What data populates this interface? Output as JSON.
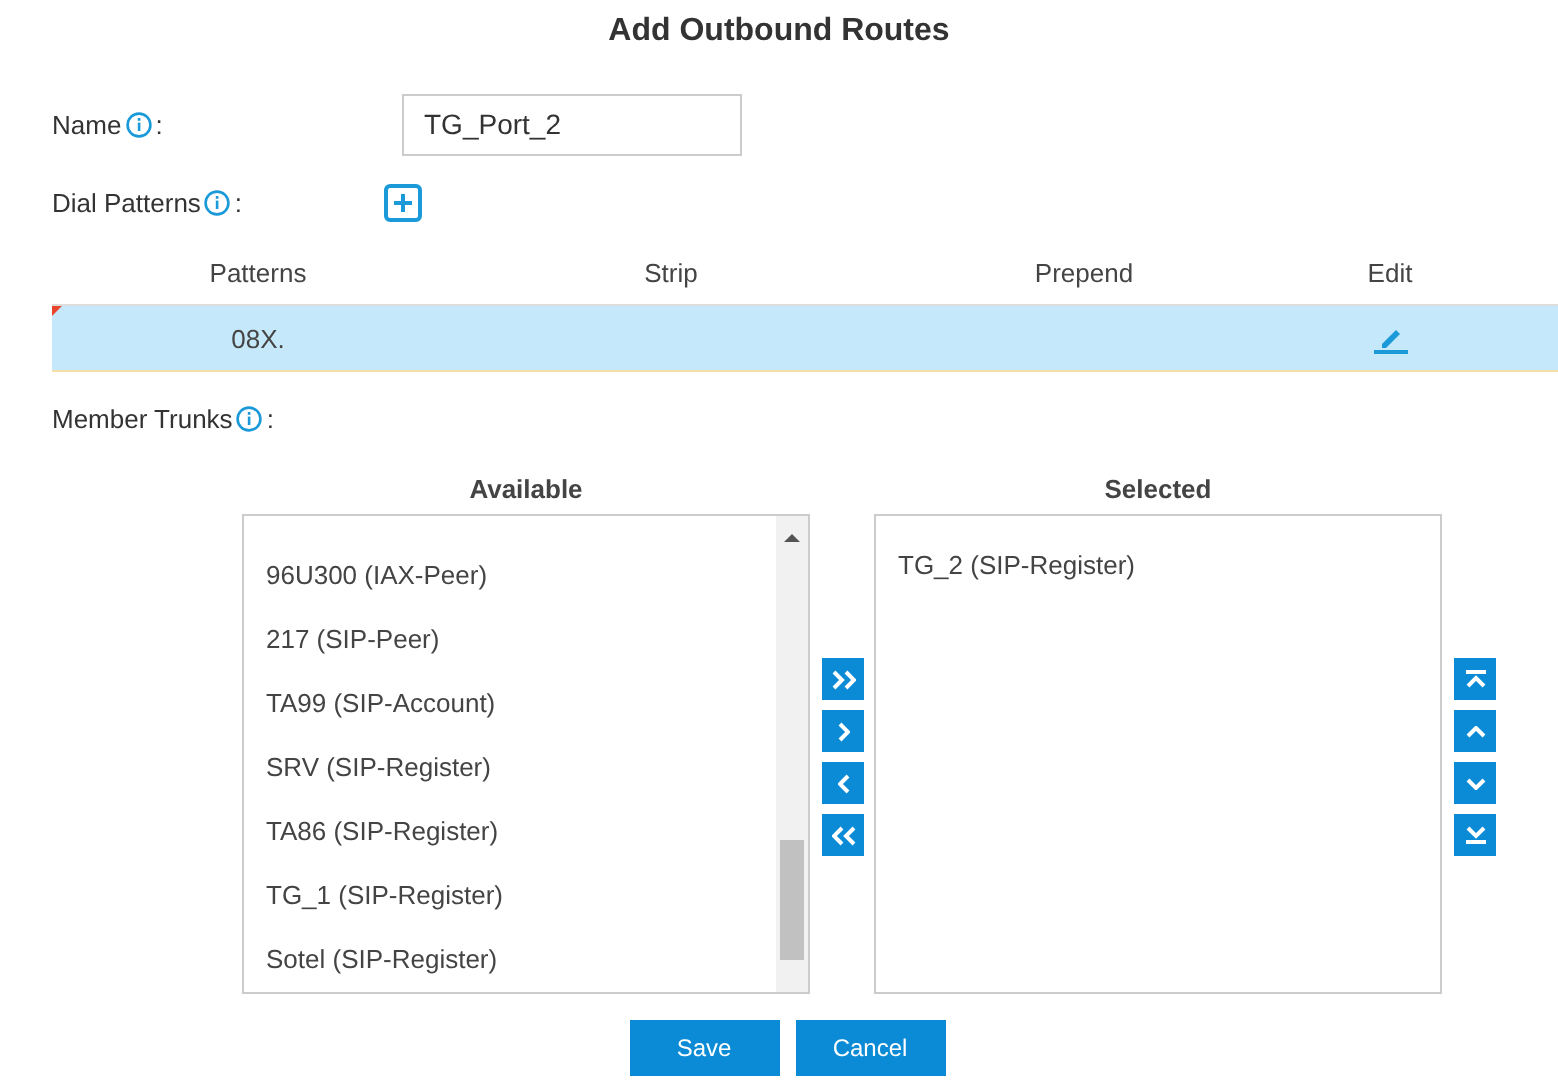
{
  "title": "Add Outbound Routes",
  "name_field": {
    "label": "Name",
    "colon": ":",
    "value": "TG_Port_2"
  },
  "dial_patterns": {
    "label": "Dial Patterns",
    "colon": ":",
    "columns": [
      "Patterns",
      "Strip",
      "Prepend",
      "Edit"
    ],
    "rows": [
      {
        "pattern": "08X.",
        "selected": true
      }
    ]
  },
  "member_trunks": {
    "label": "Member Trunks",
    "colon": ":",
    "available": {
      "heading": "Available",
      "items": [
        "96U300 (IAX-Peer)",
        "217 (SIP-Peer)",
        "TA99 (SIP-Account)",
        "SRV (SIP-Register)",
        "TA86 (SIP-Register)",
        "TG_1 (SIP-Register)",
        "Sotel (SIP-Register)"
      ]
    },
    "selected": {
      "heading": "Selected",
      "items": [
        "TG_2 (SIP-Register)"
      ]
    }
  },
  "buttons": [
    {
      "kind": "primary",
      "label": "Save"
    },
    {
      "kind": "primary",
      "label": "Cancel"
    }
  ]
}
